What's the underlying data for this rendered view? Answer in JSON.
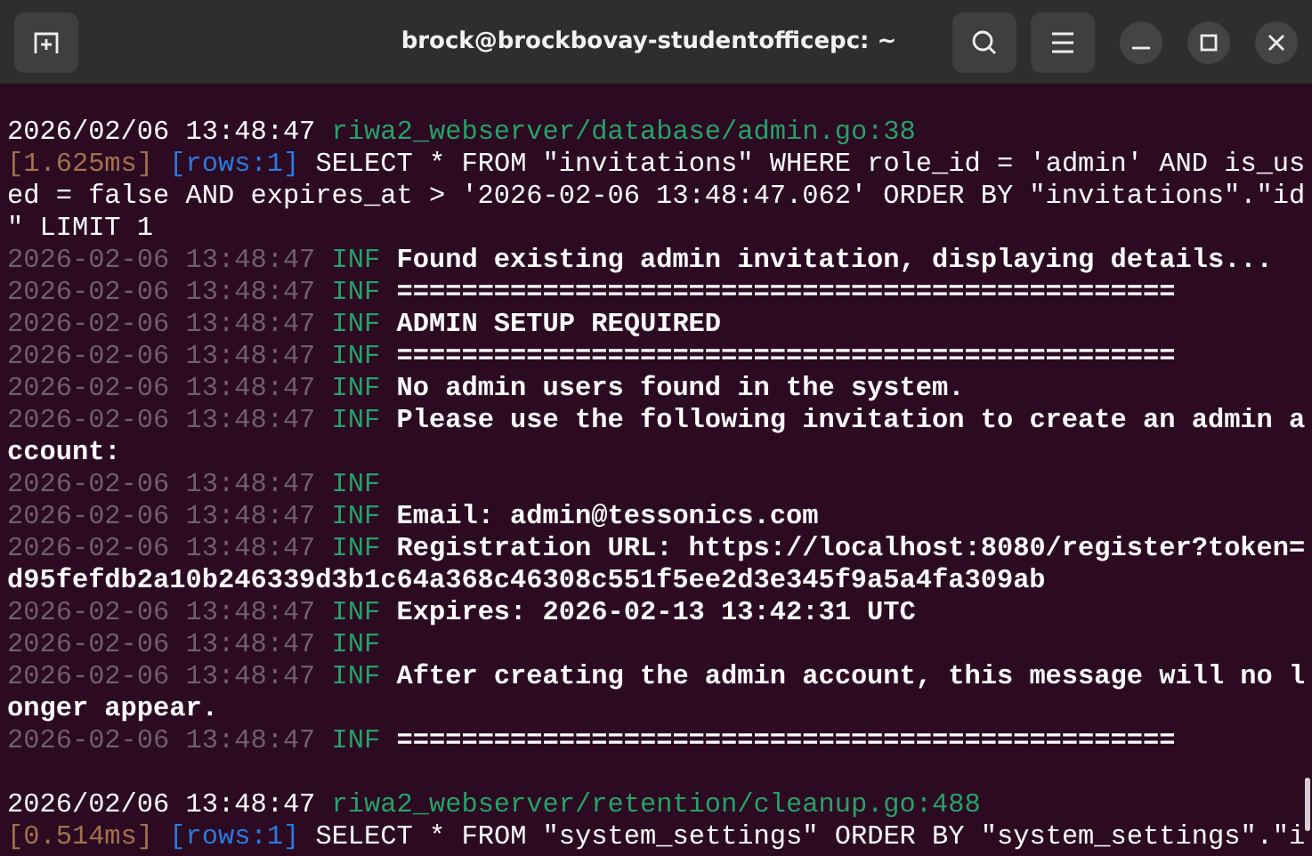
{
  "window": {
    "title": "brock@brockbovay-studentofficepc: ~"
  },
  "terminal": {
    "lines": [
      {
        "kind": "blank"
      },
      {
        "kind": "source",
        "timestamp": "2026/02/06 13:48:47",
        "path": "riwa2_webserver/database/admin.go:38"
      },
      {
        "kind": "sql",
        "duration": "[1.625ms]",
        "rows": "[rows:1]",
        "query": "SELECT * FROM \"invitations\" WHERE role_id = 'admin' AND is_used = false AND expires_at > '2026-02-06 13:48:47.062' ORDER BY \"invitations\".\"id\" LIMIT 1"
      },
      {
        "kind": "log",
        "timestamp": "2026-02-06 13:48:47",
        "level": "INF",
        "message": "Found existing admin invitation, displaying details..."
      },
      {
        "kind": "log",
        "timestamp": "2026-02-06 13:48:47",
        "level": "INF",
        "message": "================================================"
      },
      {
        "kind": "log",
        "timestamp": "2026-02-06 13:48:47",
        "level": "INF",
        "message": "ADMIN SETUP REQUIRED"
      },
      {
        "kind": "log",
        "timestamp": "2026-02-06 13:48:47",
        "level": "INF",
        "message": "================================================"
      },
      {
        "kind": "log",
        "timestamp": "2026-02-06 13:48:47",
        "level": "INF",
        "message": "No admin users found in the system."
      },
      {
        "kind": "log",
        "timestamp": "2026-02-06 13:48:47",
        "level": "INF",
        "message": "Please use the following invitation to create an admin account:"
      },
      {
        "kind": "log",
        "timestamp": "2026-02-06 13:48:47",
        "level": "INF"
      },
      {
        "kind": "log",
        "timestamp": "2026-02-06 13:48:47",
        "level": "INF",
        "message": "Email: admin@tessonics.com"
      },
      {
        "kind": "log",
        "timestamp": "2026-02-06 13:48:47",
        "level": "INF",
        "message": "Registration URL: https://localhost:8080/register?token=d95fefdb2a10b246339d3b1c64a368c46308c551f5ee2d3e345f9a5a4fa309ab"
      },
      {
        "kind": "log",
        "timestamp": "2026-02-06 13:48:47",
        "level": "INF",
        "message": "Expires: 2026-02-13 13:42:31 UTC"
      },
      {
        "kind": "log",
        "timestamp": "2026-02-06 13:48:47",
        "level": "INF"
      },
      {
        "kind": "log",
        "timestamp": "2026-02-06 13:48:47",
        "level": "INF",
        "message": "After creating the admin account, this message will no longer appear."
      },
      {
        "kind": "log",
        "timestamp": "2026-02-06 13:48:47",
        "level": "INF",
        "message": "================================================"
      },
      {
        "kind": "blank"
      },
      {
        "kind": "source",
        "timestamp": "2026/02/06 13:48:47",
        "path": "riwa2_webserver/retention/cleanup.go:488"
      },
      {
        "kind": "sql",
        "duration": "[0.514ms]",
        "rows": "[rows:1]",
        "query": "SELECT * FROM \"system_settings\" ORDER BY \"system_settings\".\"i"
      }
    ]
  }
}
